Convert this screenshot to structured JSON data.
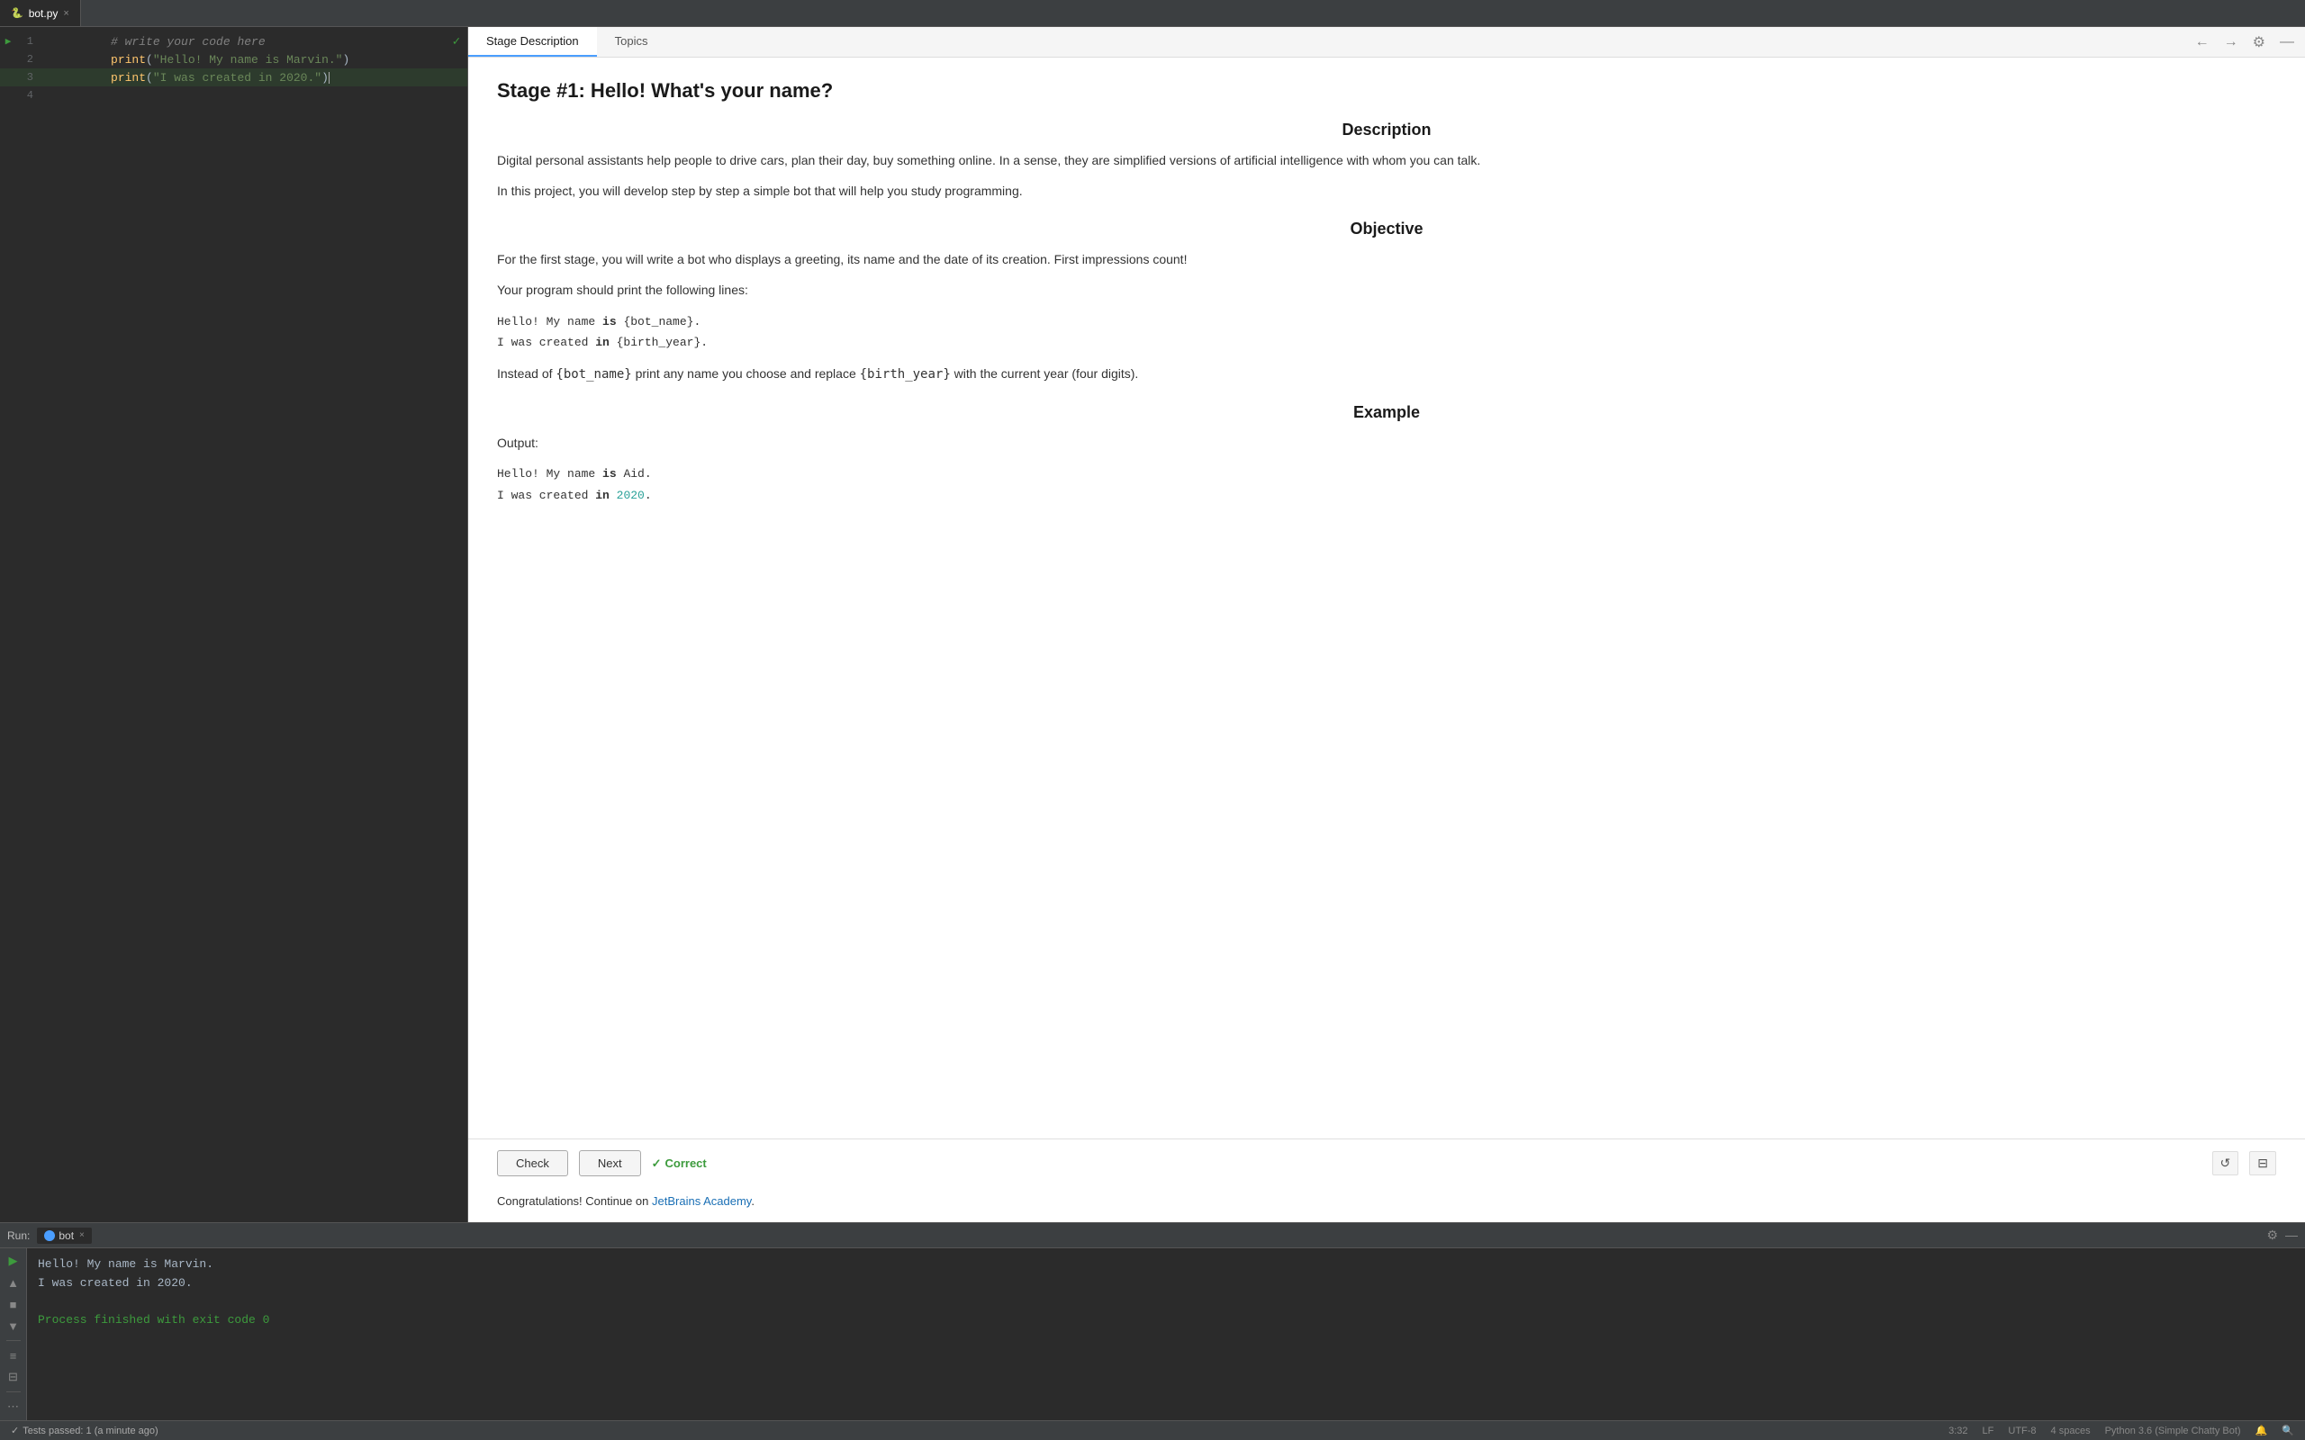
{
  "tab": {
    "filename": "bot.py",
    "close_icon": "×"
  },
  "editor": {
    "lines": [
      {
        "number": 1,
        "has_run_icon": true,
        "content_type": "comment",
        "content": "# write your code here"
      },
      {
        "number": 2,
        "has_run_icon": false,
        "content_type": "code",
        "content": "print(\"Hello! My name is Marvin.\")"
      },
      {
        "number": 3,
        "has_run_icon": false,
        "content_type": "code",
        "content": "print(\"I was created in 2020.\")"
      },
      {
        "number": 4,
        "has_run_icon": false,
        "content_type": "empty",
        "content": ""
      }
    ]
  },
  "desc_panel": {
    "tabs": [
      "Stage Description",
      "Topics"
    ],
    "active_tab": "Stage Description",
    "stage_title": "Stage #1: Hello! What's your name?",
    "description_heading": "Description",
    "description_text_1": "Digital personal assistants help people to drive cars, plan their day, buy something online. In a sense, they are simplified versions of artificial intelligence with whom you can talk.",
    "description_text_2": "In this project, you will develop step by step a simple bot that will help you study programming.",
    "objective_heading": "Objective",
    "objective_text_1": "For the first stage, you will write a bot who displays a greeting, its name and the date of its creation. First impressions count!",
    "objective_text_2": "Your program should print the following lines:",
    "code_example_1_pre": "Hello! My name ",
    "code_example_1_kw": "is",
    "code_example_1_post": " {bot_name}.",
    "code_example_2_pre": "I was created ",
    "code_example_2_kw": "in",
    "code_example_2_post": " {birth_year}.",
    "objective_text_3_pre": "Instead of ",
    "objective_text_3_code1": "{bot_name}",
    "objective_text_3_mid": " print any name you choose and replace ",
    "objective_text_3_code2": "{birth_year}",
    "objective_text_3_post": " with the current year (four digits).",
    "example_heading": "Example",
    "output_label": "Output:",
    "output_line1_pre": "Hello! My name ",
    "output_line1_kw": "is",
    "output_line1_post": " Aid.",
    "output_line2_pre": "I was created ",
    "output_line2_kw": "in",
    "output_line2_val": "2020",
    "output_line2_post": ".",
    "check_label": "Check",
    "next_label": "Next",
    "correct_label": "Correct",
    "congrats_text_pre": "Congratulations! Continue on ",
    "congrats_link": "JetBrains Academy",
    "congrats_text_post": "."
  },
  "run_panel": {
    "label": "Run:",
    "tab_name": "bot",
    "close_icon": "×",
    "output_lines": [
      "Hello! My name is Marvin.",
      "I was created in 2020.",
      "",
      "Process finished with exit code 0"
    ]
  },
  "status_bar": {
    "test_text": "Tests passed: 1 (a minute ago)",
    "position": "3:32",
    "line_ending": "LF",
    "encoding": "UTF-8",
    "indent": "4 spaces",
    "python_version": "Python 3.6 (Simple Chatty Bot)"
  }
}
